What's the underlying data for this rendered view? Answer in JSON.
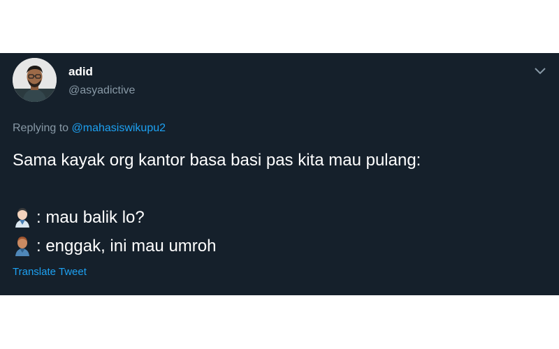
{
  "tweet": {
    "display_name": "adid",
    "handle": "@asyadictive",
    "replying_prefix": "Replying to ",
    "replying_to": "@mahasiswikupu2",
    "text_main": "Sama kayak org kantor basa basi pas kita mau pulang:",
    "line1": ": mau balik lo?",
    "line2": ": enggak, ini mau umroh",
    "line1_emoji": "man-light-skin-emoji",
    "line2_emoji": "man-medium-skin-emoji",
    "translate_label": "Translate Tweet"
  },
  "colors": {
    "background": "#15202b",
    "text": "#ffffff",
    "muted": "#8899a6",
    "link": "#1da1f2"
  }
}
